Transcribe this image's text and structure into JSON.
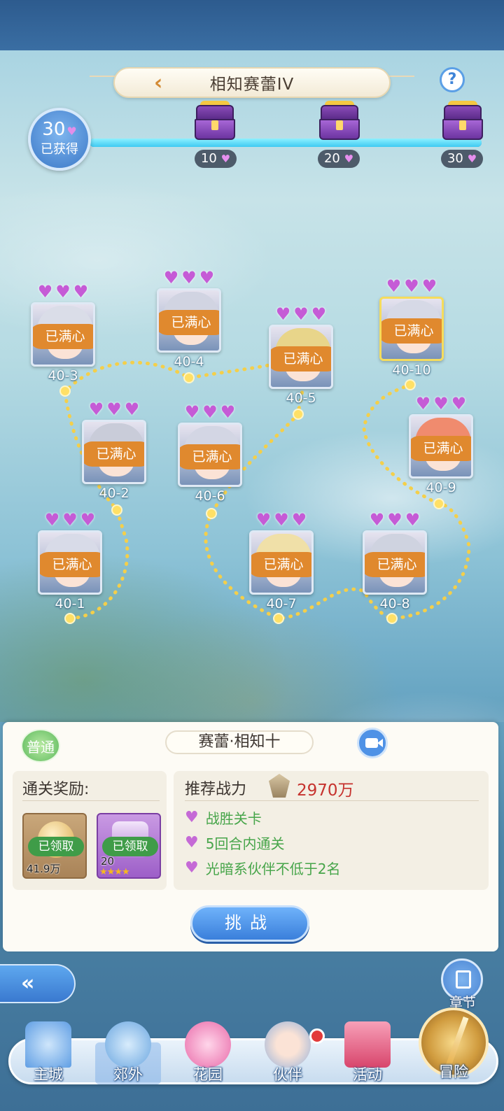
{
  "header": {
    "title": "相知赛蕾IV",
    "help": "?"
  },
  "progress": {
    "hearts_obtained": "30",
    "obtained_label": "已获得",
    "fill_fraction": 1.0,
    "milestones": [
      {
        "value": "10"
      },
      {
        "value": "20"
      },
      {
        "value": "30"
      }
    ]
  },
  "stages": [
    {
      "code": "40-1",
      "hearts": 3,
      "status": "已满心",
      "hair": "#d8dbe8"
    },
    {
      "code": "40-2",
      "hearts": 3,
      "status": "已满心",
      "hair": "#c9ccd9"
    },
    {
      "code": "40-3",
      "hearts": 3,
      "status": "已满心",
      "hair": "#dadde8"
    },
    {
      "code": "40-4",
      "hearts": 3,
      "status": "已满心",
      "hair": "#d1d4e2"
    },
    {
      "code": "40-5",
      "hearts": 3,
      "status": "已满心",
      "hair": "#e8d58a"
    },
    {
      "code": "40-6",
      "hearts": 3,
      "status": "已满心",
      "hair": "#d3d6e4"
    },
    {
      "code": "40-7",
      "hearts": 3,
      "status": "已满心",
      "hair": "#f0e0a8"
    },
    {
      "code": "40-8",
      "hearts": 3,
      "status": "已满心",
      "hair": "#cfd3e0"
    },
    {
      "code": "40-9",
      "hearts": 3,
      "status": "已满心",
      "hair": "#f08b6e"
    },
    {
      "code": "40-10",
      "hearts": 3,
      "status": "已满心",
      "hair": "#d6d9e6",
      "selected": true
    }
  ],
  "panel": {
    "mode": "普通",
    "stage_name": "赛蕾·相知十",
    "rewards_title": "通关奖励:",
    "rewards": [
      {
        "status": "已领取",
        "quantity": "41.9万"
      },
      {
        "status": "已领取",
        "quantity": "20",
        "stars": 4
      }
    ],
    "power_label": "推荐战力",
    "power_value": "2970万",
    "conditions": [
      "战胜关卡",
      "5回合内通关",
      "光暗系伙伴不低于2名"
    ],
    "challenge_label": "挑战"
  },
  "side": {
    "chapter_label": "章节"
  },
  "nav": {
    "items": [
      {
        "label": "主城"
      },
      {
        "label": "郊外",
        "active": true
      },
      {
        "label": "花园"
      },
      {
        "label": "伙伴",
        "badge": true
      },
      {
        "label": "活动"
      },
      {
        "label": "冒险"
      }
    ]
  },
  "colors": {
    "accent_blue": "#3a7fdb",
    "stamp_orange": "#e0892e",
    "condition_green": "#47a54a",
    "power_red": "#c6322e",
    "heart_purple": "#c55bd6"
  }
}
